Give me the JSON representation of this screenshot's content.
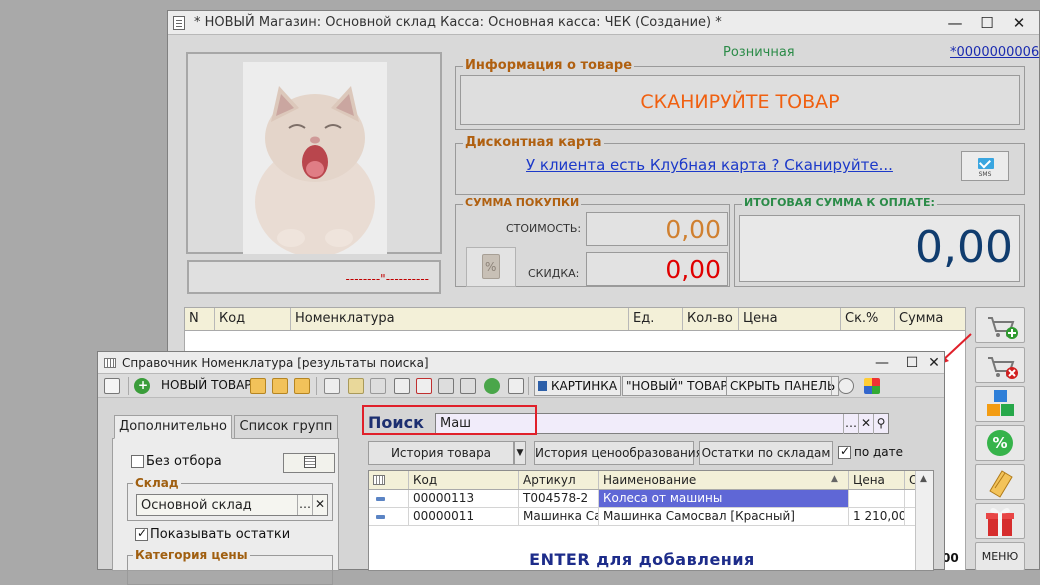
{
  "main": {
    "title": "* НОВЫЙ Магазин: Основной склад Касса: Основная касса: ЧЕК (Создание) *",
    "price_type": "Розничная",
    "card_number": "*0000000006",
    "product_placeholder": "--------\"----------",
    "product_info": {
      "title": "Информация о товаре",
      "scan_prompt": "СКАНИРУЙТЕ ТОВАР"
    },
    "discount_card": {
      "title": "Дисконтная карта",
      "club_link": "У клиента есть Клубная карта ? Сканируйте...",
      "sms_label": "SMS"
    },
    "purchase_sum": {
      "title": "СУММА ПОКУПКИ",
      "cost_label": "СТОИМОСТЬ:",
      "cost_value": "0,00",
      "discount_label": "СКИДКА:",
      "discount_value": "0,00",
      "discount_icon": "%"
    },
    "total": {
      "title": "ИТОГОВАЯ СУММА К ОПЛАТЕ:",
      "value": "0,00"
    },
    "grid_columns": [
      "N",
      "Код",
      "Номенклатура",
      "Ед.",
      "Кол-во",
      "Цена",
      "Ск.%",
      "Сумма"
    ],
    "side_buttons": {
      "discount_icon": "%",
      "menu_label": "МЕНЮ"
    },
    "corner_value": "00"
  },
  "search_window": {
    "title": "Справочник Номенклатура [результаты поиска]",
    "toolbar": {
      "new_item": "НОВЫЙ ТОВАР",
      "picture": "КАРТИНКА",
      "new_item_quoted": "\"НОВЫЙ\" ТОВАР",
      "hide_panel": "СКРЫТЬ ПАНЕЛЬ"
    },
    "tabs": [
      "Дополнительно",
      "Список групп"
    ],
    "no_filter_label": "Без отбора",
    "no_filter_value": "0",
    "warehouse": {
      "title": "Склад",
      "value": "Основной склад"
    },
    "show_stock_label": "Показывать остатки",
    "price_category": {
      "title": "Категория цены"
    },
    "search": {
      "label": "Поиск",
      "value": "Маш"
    },
    "buttons": {
      "product_history": "История товара",
      "price_history": "История ценообразования",
      "stock_by_warehouse": "Остатки по складам",
      "by_date": "по дате"
    },
    "table": {
      "columns": [
        "Код",
        "Артикул",
        "Наименование",
        "Цена",
        "О"
      ],
      "rows": [
        {
          "code": "00000113",
          "article": "Т004578-2",
          "name": "Колеса от машины",
          "price": ""
        },
        {
          "code": "00000011",
          "article": "Машинка Са...",
          "name": "Машинка Самосвал [Красный]",
          "price": "1 210,00"
        }
      ]
    },
    "enter_hint": "ENTER  для добавления"
  },
  "colors": {
    "accent_orange": "#f06010",
    "group_title_brown": "#b06010",
    "total_blue": "#103c6e",
    "discount_red": "#e00000",
    "cost_orange": "#d08030",
    "link_blue": "#1c39c9",
    "highlight_red": "#e0202a"
  }
}
